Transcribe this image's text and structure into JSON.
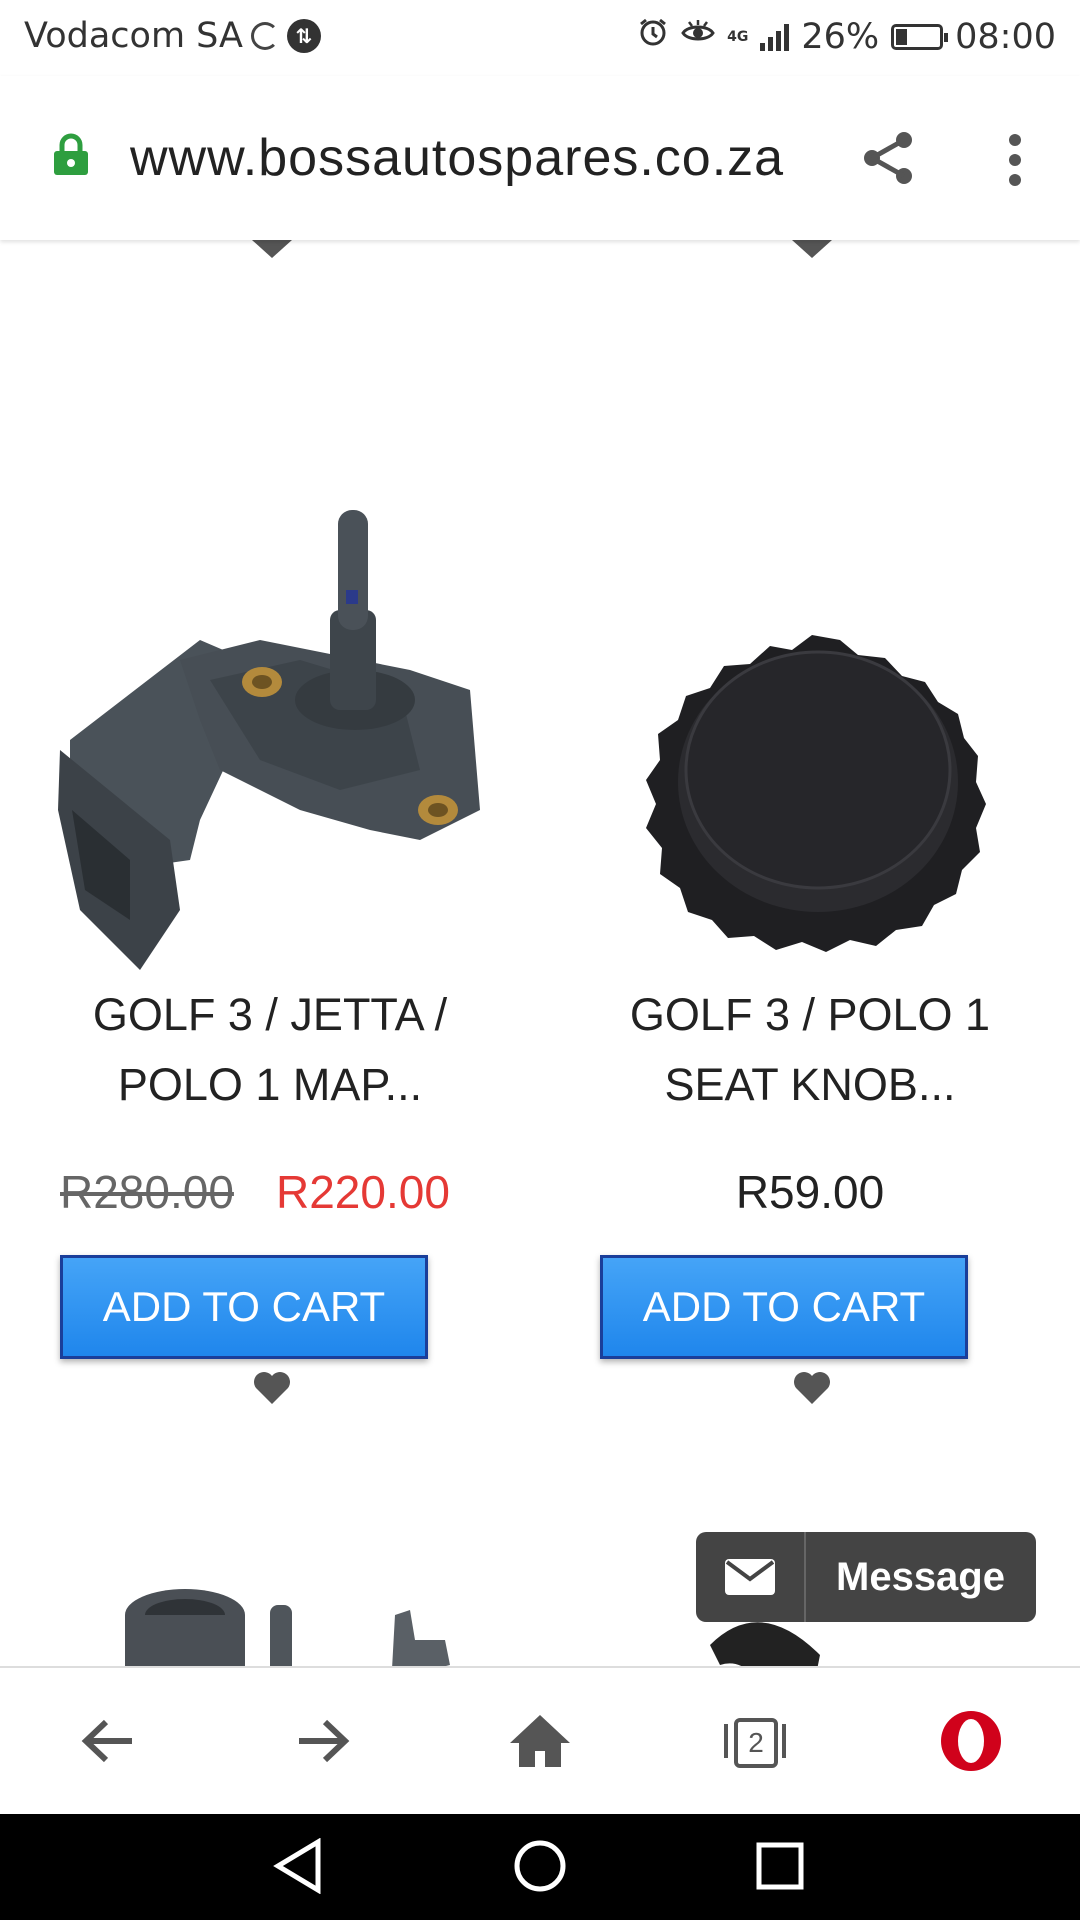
{
  "status_bar": {
    "carrier": "Vodacom SA",
    "network": "4G",
    "battery": "26%",
    "battery_level": 0.26,
    "time": "08:00"
  },
  "browser": {
    "url": "www.bossautospares.co.za",
    "tabs_count": "2"
  },
  "products": [
    {
      "title": "GOLF 3 / JETTA / POLO 1 MAP...",
      "old_price": "R280.00",
      "price": "R220.00",
      "cart_label": "ADD TO CART"
    },
    {
      "title": "GOLF 3 / POLO 1 SEAT KNOB...",
      "price": "R59.00",
      "cart_label": "ADD TO CART"
    }
  ],
  "message": {
    "label": "Message"
  },
  "colors": {
    "accent": "#2196f3",
    "sale_price": "#e53935",
    "opera": "#d0021b"
  }
}
